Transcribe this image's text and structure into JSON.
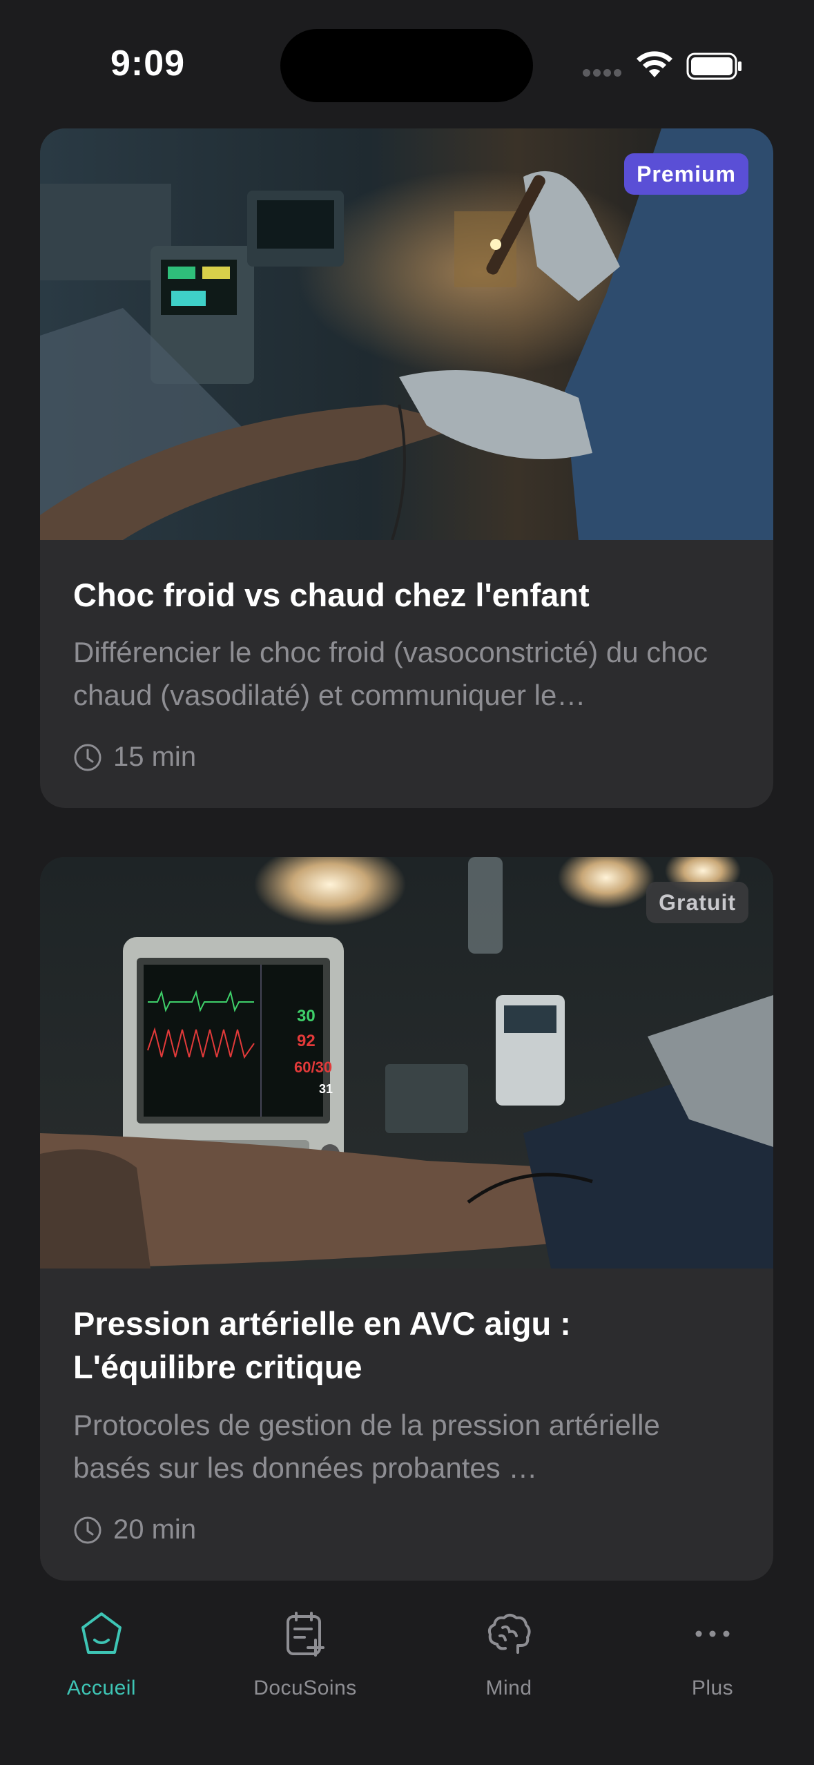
{
  "status_bar": {
    "time": "9:09"
  },
  "cards": [
    {
      "badge": "Premium",
      "title": "Choc froid vs chaud chez l'enfant",
      "description": "Différencier le choc froid (vasoconstricté) du choc chaud (vasodilaté) et communiquer le…",
      "duration": "15 min"
    },
    {
      "badge": "Gratuit",
      "title": "Pression artérielle en AVC aigu : L'équilibre critique",
      "description": "Protocoles de gestion de la pression artérielle basés sur les données probantes …",
      "duration": "20 min",
      "monitor": {
        "hr": "30",
        "spo2": "92",
        "bp": "60/30",
        "rr": "31"
      }
    }
  ],
  "tab_bar": {
    "tabs": [
      {
        "label": "Accueil",
        "icon": "home-icon",
        "active": true
      },
      {
        "label": "DocuSoins",
        "icon": "document-add-icon",
        "active": false
      },
      {
        "label": "Mind",
        "icon": "brain-icon",
        "active": false
      },
      {
        "label": "Plus",
        "icon": "more-icon",
        "active": false
      }
    ]
  },
  "colors": {
    "accent": "#3ec5b5",
    "premium": "#5a4fd6",
    "background": "#1c1c1e",
    "card": "#2c2c2e"
  }
}
